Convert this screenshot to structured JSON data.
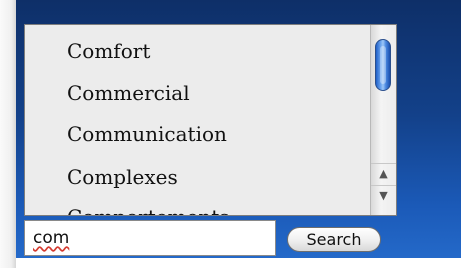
{
  "list": {
    "items": [
      {
        "label": "Comfort"
      },
      {
        "label": "Commercial"
      },
      {
        "label": "Communication"
      },
      {
        "label": "Complexes"
      },
      {
        "label": "Comportements"
      }
    ]
  },
  "scrollbar": {
    "up_glyph": "▲",
    "down_glyph": "▼"
  },
  "search": {
    "value": "com",
    "button_label": "Search"
  },
  "colors": {
    "panel_blue": "#13418a",
    "thumb_blue": "#4a88e0",
    "spellcheck_red": "#d43a2f"
  }
}
